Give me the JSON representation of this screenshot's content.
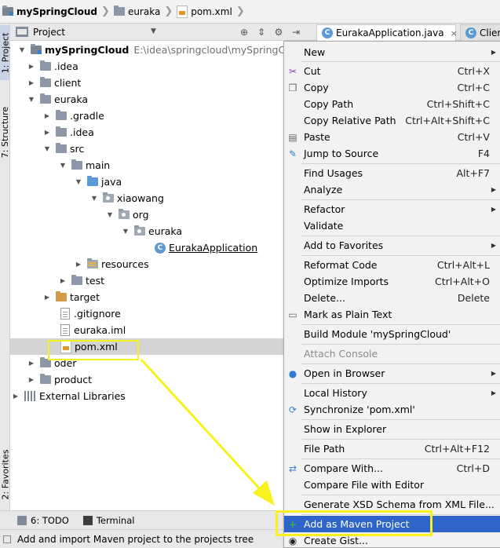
{
  "breadcrumb": {
    "root": "mySpringCloud",
    "module": "euraka",
    "file": "pom.xml"
  },
  "left_tool_tabs": {
    "project": "1: Project",
    "structure": "7: Structure",
    "favorites": "2: Favorites"
  },
  "project_panel": {
    "title": "Project"
  },
  "editor_tabs": [
    {
      "label": "EurakaApplication.java",
      "close": "×"
    },
    {
      "label": "Clien"
    }
  ],
  "tree": [
    {
      "label": "mySpringCloud",
      "path": "E:\\idea\\springcloud\\mySpringCloud"
    },
    {
      "label": ".idea"
    },
    {
      "label": "client"
    },
    {
      "label": "euraka"
    },
    {
      "label": ".gradle"
    },
    {
      "label": ".idea"
    },
    {
      "label": "src"
    },
    {
      "label": "main"
    },
    {
      "label": "java"
    },
    {
      "label": "xiaowang"
    },
    {
      "label": "org"
    },
    {
      "label": "euraka"
    },
    {
      "label": "EurakaApplication"
    },
    {
      "label": "resources"
    },
    {
      "label": "test"
    },
    {
      "label": "target"
    },
    {
      "label": ".gitignore"
    },
    {
      "label": "euraka.iml"
    },
    {
      "label": "pom.xml"
    },
    {
      "label": "oder"
    },
    {
      "label": "product"
    },
    {
      "label": "External Libraries"
    }
  ],
  "menu": [
    {
      "label": "New",
      "shortcut": ""
    },
    {
      "label": "Cut",
      "shortcut": "Ctrl+X"
    },
    {
      "label": "Copy",
      "shortcut": "Ctrl+C"
    },
    {
      "label": "Copy Path",
      "shortcut": "Ctrl+Shift+C"
    },
    {
      "label": "Copy Relative Path",
      "shortcut": "Ctrl+Alt+Shift+C"
    },
    {
      "label": "Paste",
      "shortcut": "Ctrl+V"
    },
    {
      "label": "Jump to Source",
      "shortcut": "F4"
    },
    {
      "label": "Find Usages",
      "shortcut": "Alt+F7"
    },
    {
      "label": "Analyze",
      "shortcut": ""
    },
    {
      "label": "Refactor",
      "shortcut": ""
    },
    {
      "label": "Validate",
      "shortcut": ""
    },
    {
      "label": "Add to Favorites",
      "shortcut": ""
    },
    {
      "label": "Reformat Code",
      "shortcut": "Ctrl+Alt+L"
    },
    {
      "label": "Optimize Imports",
      "shortcut": "Ctrl+Alt+O"
    },
    {
      "label": "Delete...",
      "shortcut": "Delete"
    },
    {
      "label": "Mark as Plain Text",
      "shortcut": ""
    },
    {
      "label": "Build Module 'mySpringCloud'",
      "shortcut": ""
    },
    {
      "label": "Attach Console",
      "shortcut": ""
    },
    {
      "label": "Open in Browser",
      "shortcut": ""
    },
    {
      "label": "Local History",
      "shortcut": ""
    },
    {
      "label": "Synchronize 'pom.xml'",
      "shortcut": ""
    },
    {
      "label": "Show in Explorer",
      "shortcut": ""
    },
    {
      "label": "File Path",
      "shortcut": "Ctrl+Alt+F12"
    },
    {
      "label": "Compare With...",
      "shortcut": "Ctrl+D"
    },
    {
      "label": "Compare File with Editor",
      "shortcut": ""
    },
    {
      "label": "Generate XSD Schema from XML File...",
      "shortcut": ""
    },
    {
      "label": "Add as Maven Project",
      "shortcut": ""
    },
    {
      "label": "Create Gist...",
      "shortcut": ""
    }
  ],
  "bottom_tools": {
    "todo": "6: TODO",
    "terminal": "Terminal"
  },
  "status": {
    "text": "Add and import Maven project to the projects tree"
  },
  "colors": {
    "menu_highlight": "#2f65ca",
    "annotation": "#f7f21d",
    "selection": "#d4d4d4"
  }
}
